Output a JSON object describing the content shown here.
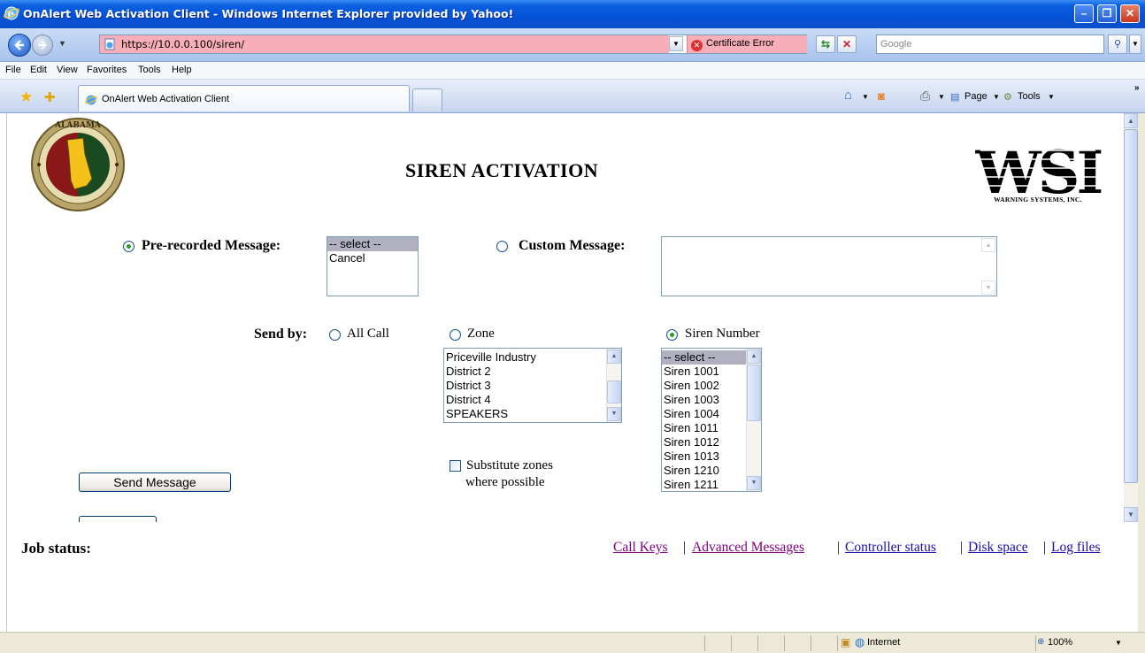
{
  "window": {
    "title": "OnAlert Web Activation Client - Windows Internet Explorer provided by Yahoo!",
    "min_glyph": "–",
    "max_glyph": "❐",
    "close_glyph": "✕"
  },
  "address": {
    "url": "https://10.0.0.100/siren/",
    "cert_error": "Certificate Error",
    "search_placeholder": "Google"
  },
  "menu": [
    "File",
    "Edit",
    "View",
    "Favorites",
    "Tools",
    "Help"
  ],
  "tab": {
    "title": "OnAlert Web Activation Client"
  },
  "command_bar": {
    "page": "Page",
    "tools": "Tools"
  },
  "page": {
    "title": "SIREN ACTIVATION",
    "seal_top_text": "ALABAMA",
    "logo_text": "WSI",
    "logo_subtext": "WARNING SYSTEMS, INC.",
    "prerecorded_label": "Pre-recorded Message:",
    "prerecorded_options": [
      "-- select --",
      "Cancel"
    ],
    "custom_label": "Custom Message:",
    "send_by_label": "Send by:",
    "all_call": "All Call",
    "zone": "Zone",
    "siren_number": "Siren Number",
    "zones": [
      "Priceville Industry",
      "District 2",
      "District 3",
      "District 4",
      "SPEAKERS"
    ],
    "sirens": [
      "-- select --",
      "Siren 1001",
      "Siren 1002",
      "Siren 1003",
      "Siren 1004",
      "Siren 1011",
      "Siren 1012",
      "Siren 1013",
      "Siren 1210",
      "Siren 1211"
    ],
    "substitute_line1": "Substitute zones",
    "substitute_line2": "where possible",
    "send_button": "Send Message",
    "job_status": "Job status:",
    "links": [
      "Call Keys",
      "Advanced Messages",
      "Controller status",
      "Disk space",
      "Log files"
    ],
    "separator": "|"
  },
  "status": {
    "zone": "Internet",
    "zoom": "100%"
  },
  "colors": {
    "url_error_bg": "#f7aeb8",
    "link": "#1a0dab",
    "visited": "#800080",
    "radio_dot": "#2d9a2d"
  }
}
